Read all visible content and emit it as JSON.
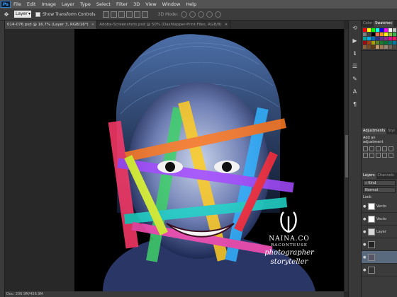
{
  "menu": {
    "logo": "Ps",
    "items": [
      "File",
      "Edit",
      "Image",
      "Layer",
      "Type",
      "Select",
      "Filter",
      "3D",
      "View",
      "Window",
      "Help"
    ]
  },
  "options": {
    "auto_select_value": "Layer",
    "show_transform_label": "Show Transform Controls",
    "mode_3d_label": "3D Mode:"
  },
  "tabs": [
    {
      "label": "014-076.psd @ 16.7% (Layer 3, RGB/16*)",
      "active": true
    },
    {
      "label": "Adobe-Screenshots.psd @ 50% (Dashlapper-Print-Files, RGB/8)",
      "active": false
    }
  ],
  "status": {
    "doc_text": "Doc: 206.9M/456.9M"
  },
  "watermark": {
    "brand": "NAINA.CO",
    "tagline": "RACONTEUSE",
    "script1": "photographer",
    "script2": "storyteller"
  },
  "panels": {
    "color_tab": "Color",
    "swatches_tab": "Swatches",
    "adjust_tab": "Adjustments",
    "styles_tab": "Styl",
    "adjust_title": "Add an adjustment",
    "layers_tab": "Layers",
    "channels_tab": "Channels",
    "kind_filter": "Kind",
    "blend_mode": "Normal",
    "lock_label": "Lock:",
    "layers": [
      {
        "name": "Vecto",
        "selected": false
      },
      {
        "name": "Vecto",
        "selected": false
      },
      {
        "name": "Layer",
        "selected": false
      },
      {
        "name": "",
        "selected": false
      },
      {
        "name": "",
        "selected": true
      },
      {
        "name": "",
        "selected": false
      }
    ]
  },
  "colors": {
    "accent": "#2d7fd0",
    "panel_bg": "#3b3b3b",
    "selected_layer": "#596a7f"
  }
}
